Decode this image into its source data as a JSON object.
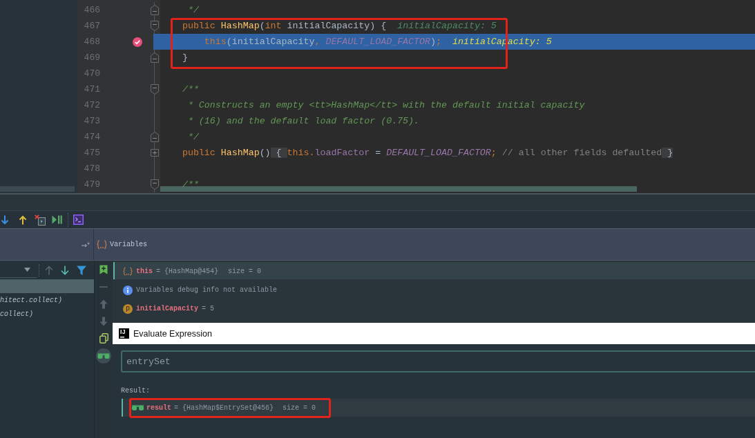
{
  "editor": {
    "lines": [
      {
        "number": "466",
        "fold_start": false,
        "fold_end": true,
        "collapsed": false,
        "breakpoint": false,
        "current": false,
        "tokens": [
          {
            "kind": "doc",
            "text": "     */"
          }
        ]
      },
      {
        "number": "467",
        "fold_start": true,
        "fold_end": false,
        "collapsed": false,
        "breakpoint": false,
        "current": false,
        "tokens": [
          {
            "kind": "keyword",
            "text": "    public "
          },
          {
            "kind": "method",
            "text": "HashMap"
          },
          {
            "kind": "plain",
            "text": "("
          },
          {
            "kind": "keyword",
            "text": "int "
          },
          {
            "kind": "plain",
            "text": "initialCapacity) {"
          }
        ],
        "inlay": "initialCapacity: 5"
      },
      {
        "number": "468",
        "fold_start": false,
        "fold_end": false,
        "collapsed": false,
        "breakpoint": true,
        "current": true,
        "tokens": [
          {
            "kind": "keyword",
            "text": "        this"
          },
          {
            "kind": "plain",
            "text": "(initialCapacity"
          },
          {
            "kind": "keyword",
            "text": ", "
          },
          {
            "kind": "constant",
            "text": "DEFAULT_LOAD_FACTOR"
          },
          {
            "kind": "plain",
            "text": ")"
          },
          {
            "kind": "keyword",
            "text": ";"
          }
        ],
        "inlay": "initialCapacity: 5"
      },
      {
        "number": "469",
        "fold_start": false,
        "fold_end": true,
        "collapsed": false,
        "breakpoint": false,
        "current": false,
        "tokens": [
          {
            "kind": "plain",
            "text": "    }"
          }
        ]
      },
      {
        "number": "470",
        "fold_start": false,
        "fold_end": false,
        "collapsed": false,
        "breakpoint": false,
        "current": false
      },
      {
        "number": "471",
        "fold_start": true,
        "fold_end": false,
        "collapsed": false,
        "breakpoint": false,
        "current": false,
        "tokens": [
          {
            "kind": "doc",
            "text": "    /**"
          }
        ]
      },
      {
        "number": "472",
        "fold_start": false,
        "fold_end": false,
        "collapsed": false,
        "breakpoint": false,
        "current": false,
        "tokens": [
          {
            "kind": "doc",
            "text": "     * Constructs an empty <tt>HashMap</tt> with the default initial capacity"
          }
        ]
      },
      {
        "number": "473",
        "fold_start": false,
        "fold_end": false,
        "collapsed": false,
        "breakpoint": false,
        "current": false,
        "tokens": [
          {
            "kind": "doc",
            "text": "     * (16) and the default load factor (0.75)."
          }
        ]
      },
      {
        "number": "474",
        "fold_start": false,
        "fold_end": true,
        "collapsed": false,
        "breakpoint": false,
        "current": false,
        "tokens": [
          {
            "kind": "doc",
            "text": "     */"
          }
        ]
      },
      {
        "number": "475",
        "fold_start": false,
        "fold_end": false,
        "collapsed": true,
        "breakpoint": false,
        "current": false,
        "tokens": [
          {
            "kind": "keyword",
            "text": "    public "
          },
          {
            "kind": "method",
            "text": "HashMap"
          },
          {
            "kind": "plain",
            "text": "()"
          },
          {
            "kind": "brace",
            "text": " { "
          },
          {
            "kind": "keyword",
            "text": "this."
          },
          {
            "kind": "field",
            "text": "loadFactor"
          },
          {
            "kind": "plain",
            "text": " = "
          },
          {
            "kind": "constant",
            "text": "DEFAULT_LOAD_FACTOR"
          },
          {
            "kind": "keyword",
            "text": ";"
          },
          {
            "kind": "comment",
            "text": " // all other fields defaulted"
          },
          {
            "kind": "brace",
            "text": " }"
          }
        ]
      },
      {
        "number": "478",
        "fold_start": false,
        "fold_end": false,
        "collapsed": false,
        "breakpoint": false,
        "current": false
      },
      {
        "number": "479",
        "fold_start": true,
        "fold_end": false,
        "collapsed": false,
        "breakpoint": false,
        "current": false,
        "tokens": [
          {
            "kind": "doc",
            "text": "    /**"
          }
        ]
      }
    ]
  },
  "debug_panel": {
    "variables_title": "Variables",
    "frames_toolbar": [
      {
        "kind": "up",
        "disabled": true
      },
      {
        "kind": "down",
        "disabled": false
      },
      {
        "kind": "filter",
        "disabled": false
      }
    ],
    "frames": [
      {
        "selected": true
      },
      {
        "label": "hitect.collect)",
        "selected": false
      },
      {
        "label": "collect)",
        "selected": false
      }
    ],
    "watch_toolbar": [
      {
        "kind": "add",
        "disabled": false,
        "pressed": false
      },
      {
        "kind": "remove",
        "disabled": true,
        "pressed": false
      },
      {
        "kind": "up",
        "disabled": true,
        "pressed": false
      },
      {
        "kind": "down",
        "disabled": true,
        "pressed": false
      },
      {
        "kind": "copy",
        "disabled": false,
        "pressed": false
      },
      {
        "kind": "glasses",
        "disabled": false,
        "pressed": true
      }
    ],
    "variables": [
      {
        "kind": "object",
        "name": "this",
        "value": "= {HashMap@454}",
        "extra": "size = 0",
        "selected": true
      },
      {
        "kind": "info",
        "text": "Variables debug info not available",
        "selected": false
      },
      {
        "kind": "param",
        "badge": "p",
        "name": "initialCapacity",
        "value": "= 5",
        "selected": false
      }
    ]
  },
  "evaluate_dialog": {
    "logo": "IJ",
    "title": "Evaluate Expression",
    "expression": "entrySet",
    "result_label": "Result:",
    "result": {
      "name": "result",
      "value": "= {HashMap$EntrySet@456}",
      "extra": "size = 0",
      "selected": true
    }
  }
}
